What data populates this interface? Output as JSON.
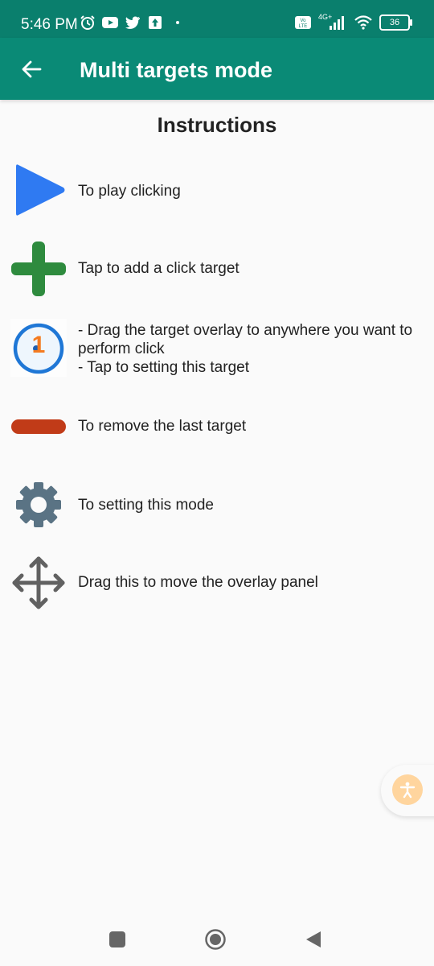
{
  "status_bar": {
    "time": "5:46 PM",
    "left_icons": [
      "alarm-icon",
      "youtube-icon",
      "twitter-icon",
      "upload-icon",
      "dot-icon"
    ],
    "right_icons": [
      "volte-icon",
      "signal-4g-icon",
      "wifi-icon",
      "battery-icon"
    ],
    "network_label": "4G+",
    "volte_label": "Vo LTE",
    "battery_level": "36"
  },
  "app_bar": {
    "title": "Multi targets mode",
    "back_icon": "arrow-left-icon"
  },
  "content": {
    "heading": "Instructions",
    "items": [
      {
        "icon": "play-icon",
        "text": "To play clicking"
      },
      {
        "icon": "plus-icon",
        "text": "Tap to add a click target"
      },
      {
        "icon": "target-icon",
        "target_number": "1",
        "text": "- Drag the target overlay to anywhere you want to perform click\n- Tap to setting this target"
      },
      {
        "icon": "minus-icon",
        "text": "To remove the last target"
      },
      {
        "icon": "gear-icon",
        "text": "To setting this mode"
      },
      {
        "icon": "move-icon",
        "text": "Drag this to move the overlay panel"
      }
    ]
  },
  "colors": {
    "status_bar": "#0a7f6d",
    "app_bar": "#0a8a76",
    "play": "#2f7af2",
    "plus": "#2e8b3e",
    "target_ring": "#1f77d6",
    "target_number": "#f47b20",
    "minus": "#c13b18",
    "gear": "#5a7384",
    "move": "#616161",
    "accessibility": "#ffd59e"
  },
  "nav_bar": {
    "buttons": [
      "recents-icon",
      "home-icon",
      "back-icon"
    ]
  }
}
